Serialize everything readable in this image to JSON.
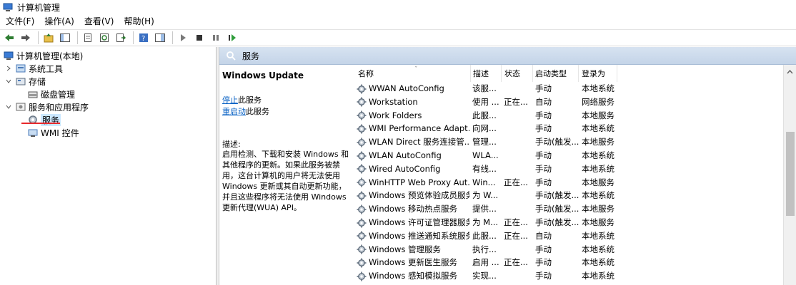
{
  "window": {
    "title": "计算机管理"
  },
  "menu": [
    "文件(F)",
    "操作(A)",
    "查看(V)",
    "帮助(H)"
  ],
  "tree": {
    "root": "计算机管理(本地)",
    "system_tools": "系统工具",
    "storage": "存储",
    "disk_management": "磁盘管理",
    "services_apps": "服务和应用程序",
    "services": "服务",
    "wmi": "WMI 控件"
  },
  "panel": {
    "header": "服务"
  },
  "detail": {
    "service_name": "Windows Update",
    "stop_link": "停止",
    "stop_suffix": "此服务",
    "restart_link": "重启动",
    "restart_suffix": "此服务",
    "desc_label": "描述:",
    "description": "启用检测、下载和安装 Windows 和其他程序的更新。如果此服务被禁用，这台计算机的用户将无法使用 Windows 更新或其自动更新功能，并且这些程序将无法使用 Windows 更新代理(WUA) API。"
  },
  "columns": {
    "name": "名称",
    "description": "描述",
    "status": "状态",
    "startup": "启动类型",
    "logon": "登录为"
  },
  "services": [
    {
      "name": "WWAN AutoConfig",
      "desc": "该服...",
      "status": "",
      "startup": "手动",
      "logon": "本地系统"
    },
    {
      "name": "Workstation",
      "desc": "使用 ...",
      "status": "正在...",
      "startup": "自动",
      "logon": "网络服务"
    },
    {
      "name": "Work Folders",
      "desc": "此服...",
      "status": "",
      "startup": "手动",
      "logon": "本地服务"
    },
    {
      "name": "WMI Performance Adapt...",
      "desc": "向网...",
      "status": "",
      "startup": "手动",
      "logon": "本地系统"
    },
    {
      "name": "WLAN Direct 服务连接管...",
      "desc": "管理...",
      "status": "",
      "startup": "手动(触发...",
      "logon": "本地服务"
    },
    {
      "name": "WLAN AutoConfig",
      "desc": "WLA...",
      "status": "",
      "startup": "手动",
      "logon": "本地系统"
    },
    {
      "name": "Wired AutoConfig",
      "desc": "有线...",
      "status": "",
      "startup": "手动",
      "logon": "本地系统"
    },
    {
      "name": "WinHTTP Web Proxy Aut...",
      "desc": "Win...",
      "status": "正在...",
      "startup": "手动",
      "logon": "本地服务"
    },
    {
      "name": "Windows 预览体验成员服务",
      "desc": "为 W...",
      "status": "",
      "startup": "手动(触发...",
      "logon": "本地系统"
    },
    {
      "name": "Windows 移动热点服务",
      "desc": "提供...",
      "status": "",
      "startup": "手动(触发...",
      "logon": "本地服务"
    },
    {
      "name": "Windows 许可证管理器服务",
      "desc": "为 M...",
      "status": "正在...",
      "startup": "手动(触发...",
      "logon": "本地服务"
    },
    {
      "name": "Windows 推送通知系统服务",
      "desc": "此服...",
      "status": "正在...",
      "startup": "自动",
      "logon": "本地系统"
    },
    {
      "name": "Windows 管理服务",
      "desc": "执行...",
      "status": "",
      "startup": "手动",
      "logon": "本地系统"
    },
    {
      "name": "Windows 更新医生服务",
      "desc": "启用 ...",
      "status": "正在...",
      "startup": "手动",
      "logon": "本地系统"
    },
    {
      "name": "Windows 感知模拟服务",
      "desc": "实现...",
      "status": "",
      "startup": "手动",
      "logon": "本地系统"
    }
  ]
}
